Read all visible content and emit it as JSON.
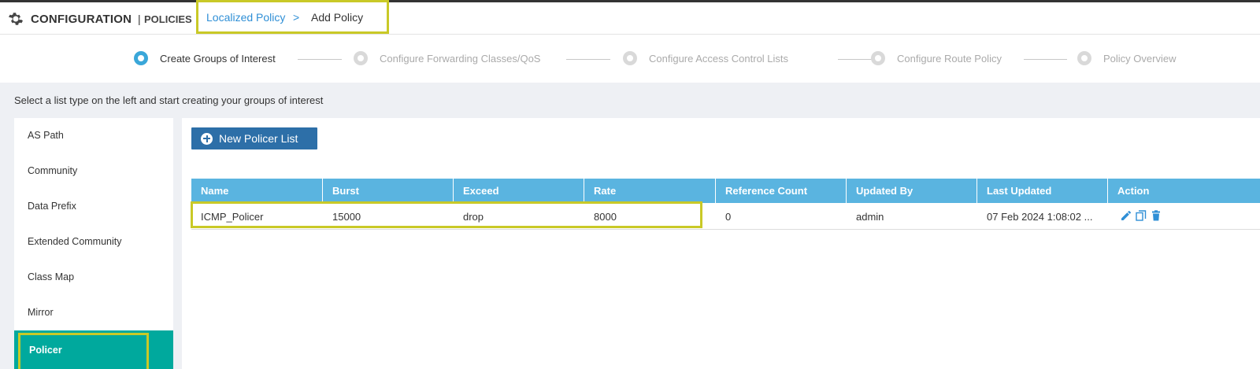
{
  "header": {
    "title": "CONFIGURATION",
    "separator": "|",
    "subtitle": "POLICIES",
    "breadcrumb_link": "Localized Policy",
    "breadcrumb_arrow": ">",
    "breadcrumb_current": "Add Policy",
    "icon": "gear-icon"
  },
  "stepper": {
    "steps": [
      {
        "label": "Create Groups of Interest",
        "active": true
      },
      {
        "label": "Configure Forwarding Classes/QoS",
        "active": false
      },
      {
        "label": "Configure Access Control Lists",
        "active": false
      },
      {
        "label": "Configure Route Policy",
        "active": false
      },
      {
        "label": "Policy Overview",
        "active": false
      }
    ]
  },
  "instruction": "Select a list type on the left and start creating your groups of interest",
  "sidebar": {
    "items": [
      {
        "label": "AS Path"
      },
      {
        "label": "Community"
      },
      {
        "label": "Data Prefix"
      },
      {
        "label": "Extended Community"
      },
      {
        "label": "Class Map"
      },
      {
        "label": "Mirror"
      },
      {
        "label": "Policer",
        "active": true
      }
    ]
  },
  "main": {
    "new_button_label": "New Policer List",
    "columns": [
      "Name",
      "Burst",
      "Exceed",
      "Rate",
      "Reference Count",
      "Updated By",
      "Last Updated",
      "Action"
    ],
    "rows": [
      {
        "name": "ICMP_Policer",
        "burst": "15000",
        "exceed": "drop",
        "rate": "8000",
        "reference_count": "0",
        "updated_by": "admin",
        "last_updated": "07 Feb 2024 1:08:02 ..."
      }
    ],
    "action_icons": [
      "edit-icon",
      "copy-icon",
      "delete-icon"
    ]
  },
  "colors": {
    "accent": "#00a99d",
    "table_header": "#5ab4e0",
    "button": "#2d6fa8",
    "highlight": "#c9c927",
    "link": "#2f8fd6"
  }
}
